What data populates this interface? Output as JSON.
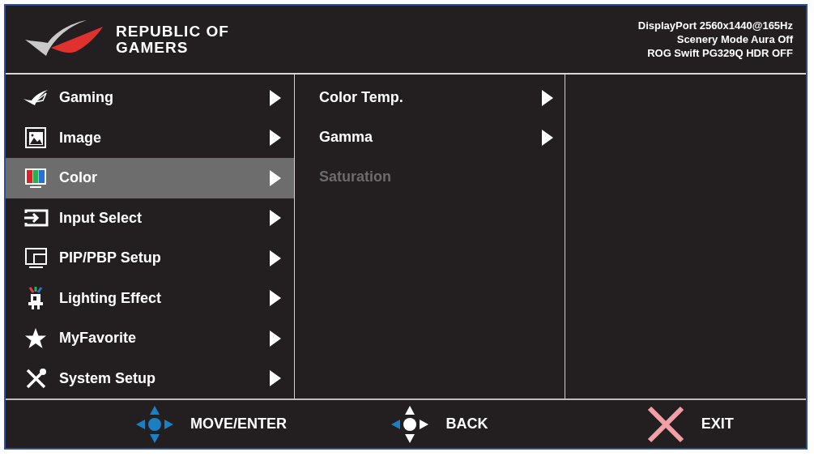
{
  "brand": {
    "line_1": "REPUBLIC OF",
    "line_2": "GAMERS"
  },
  "status": [
    "DisplayPort 2560x1440@165Hz",
    "Scenery Mode Aura Off",
    "ROG Swift PG329Q HDR OFF"
  ],
  "menu": [
    {
      "label": "Gaming",
      "kind": "rog",
      "selected": false
    },
    {
      "label": "Image",
      "kind": "image",
      "selected": false
    },
    {
      "label": "Color",
      "kind": "color",
      "selected": true
    },
    {
      "label": "Input Select",
      "kind": "input",
      "selected": false
    },
    {
      "label": "PIP/PBP Setup",
      "kind": "pip",
      "selected": false
    },
    {
      "label": "Lighting Effect",
      "kind": "light",
      "selected": false
    },
    {
      "label": "MyFavorite",
      "kind": "star",
      "selected": false
    },
    {
      "label": "System Setup",
      "kind": "tools",
      "selected": false
    }
  ],
  "submenu": [
    {
      "label": "Color Temp.",
      "disabled": false
    },
    {
      "label": "Gamma",
      "disabled": false
    },
    {
      "label": "Saturation",
      "disabled": true
    }
  ],
  "footer": [
    {
      "kind": "move",
      "label": "MOVE/ENTER"
    },
    {
      "kind": "back",
      "label": "BACK"
    },
    {
      "kind": "exit",
      "label": "EXIT"
    }
  ]
}
